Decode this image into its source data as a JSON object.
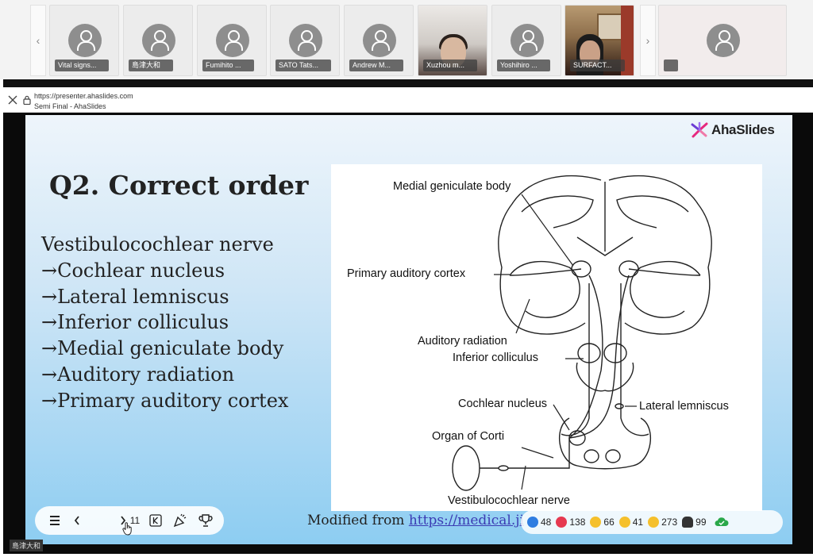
{
  "participants": [
    {
      "name": "Vital signs..."
    },
    {
      "name": "島津大和"
    },
    {
      "name": "Fumihito ..."
    },
    {
      "name": "SATO Tats..."
    },
    {
      "name": "Andrew M..."
    },
    {
      "name": "Xuzhou m..."
    },
    {
      "name": "Yoshihiro ..."
    },
    {
      "name": "SURFACT..."
    },
    {
      "name": ""
    }
  ],
  "browser": {
    "url": "https://presenter.ahaslides.com",
    "page_title": "Semi Final - AhaSlides"
  },
  "slide": {
    "brand": "AhaSlides",
    "title": "Q2. Correct order",
    "answer_lines": [
      "Vestibulocochlear nerve",
      "→Cochlear nucleus",
      "→Lateral lemniscus",
      "→Inferior colliculus",
      "→Medial geniculate body",
      "→Auditory radiation",
      "→Primary auditory cortex"
    ],
    "figure_labels": {
      "medial_geniculate": "Medial geniculate body",
      "primary_auditory_cortex": "Primary auditory cortex",
      "auditory_radiation": "Auditory radiation",
      "inferior_colliculus": "Inferior colliculus",
      "cochlear_nucleus": "Cochlear nucleus",
      "lateral_lemniscus": "Lateral lemniscus",
      "organ_of_corti": "Organ of Corti",
      "vestibulocochlear_nerve": "Vestibulocochlear nerve"
    },
    "credit_prefix": "Modified from ",
    "credit_link": "https://medical.ji"
  },
  "controls": {
    "page": "11"
  },
  "reactions": {
    "like": "48",
    "heart": "138",
    "laugh": "66",
    "wow": "41",
    "sad": "273",
    "audience": "99"
  },
  "presenter_name": "島津大和",
  "colors": {
    "slide_top": "#eef5fb",
    "slide_bottom": "#8dcdf2",
    "brand_pink": "#e6287e",
    "brand_purple": "#6b3cd4",
    "link": "#3b3bb3"
  }
}
